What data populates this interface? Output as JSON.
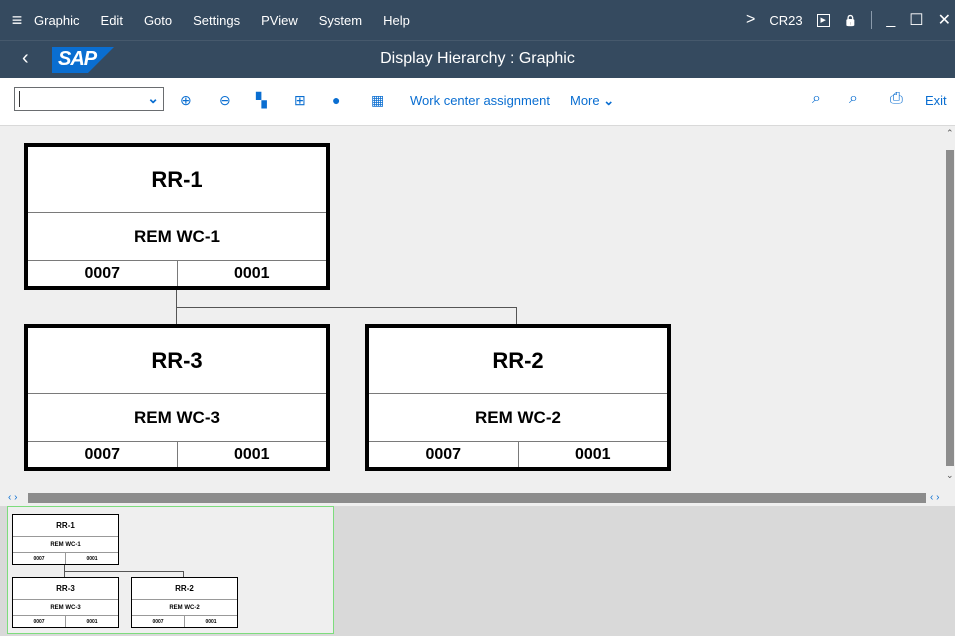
{
  "menubar": {
    "items": [
      "Graphic",
      "Edit",
      "Goto",
      "Settings",
      "PView",
      "System",
      "Help"
    ],
    "tcode": "CR23",
    "expand_glyph": ">",
    "run_glyph": "▶",
    "lock_glyph": "🔒",
    "minimize_glyph": "_",
    "maximize_glyph": "☐",
    "close_glyph": "✕",
    "hamburger_glyph": "≡"
  },
  "titlebar": {
    "title": "Display Hierarchy : Graphic",
    "logo_text": "SAP",
    "back_glyph": "‹"
  },
  "toolbar": {
    "dropdown_value": "",
    "dropdown_caret": "⌄",
    "zoom_in_glyph": "⊕",
    "zoom_out_glyph": "⊖",
    "layout1_glyph": "▚",
    "layout2_glyph": "⊞",
    "hat_glyph": "●",
    "calc_glyph": "▦",
    "work_center_assignment": "Work center assignment",
    "more_label": "More",
    "more_caret": "⌄",
    "search_glyph": "⌕",
    "search_plus_glyph": "⌕",
    "print_glyph": "⎙",
    "exit_label": "Exit"
  },
  "scrollbars": {
    "up_glyph": "⌃",
    "down_glyph": "⌄",
    "left_right_glyph": "‹ ›"
  },
  "hierarchy": {
    "nodes": [
      {
        "id": "RR-1",
        "work_center": "REM WC-1",
        "left_code": "0007",
        "right_code": "0001"
      },
      {
        "id": "RR-3",
        "work_center": "REM WC-3",
        "left_code": "0007",
        "right_code": "0001"
      },
      {
        "id": "RR-2",
        "work_center": "REM WC-2",
        "left_code": "0007",
        "right_code": "0001"
      }
    ]
  },
  "colors": {
    "shell": "#354a5f",
    "accent": "#0a6ed1",
    "canvas": "#efefef",
    "overview_border": "#7ddc7d"
  }
}
